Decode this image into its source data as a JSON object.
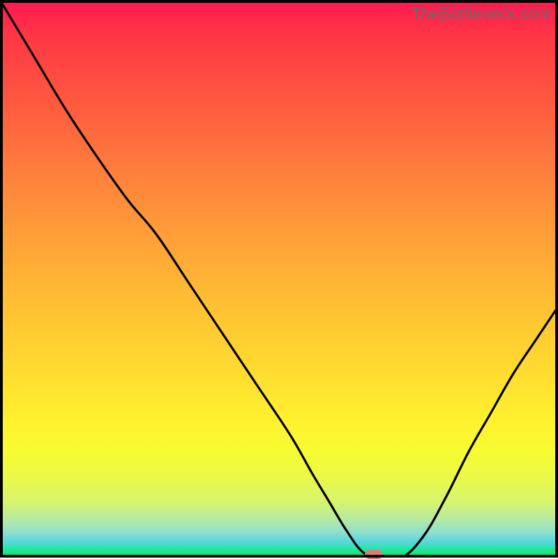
{
  "watermark": "TheBottleneck.com",
  "chart_data": {
    "type": "line",
    "title": "",
    "xlabel": "",
    "ylabel": "",
    "xlim": [
      0,
      100
    ],
    "ylim": [
      0,
      100
    ],
    "x": [
      0,
      6,
      12,
      18,
      23,
      28,
      34,
      40,
      46,
      52,
      56,
      59,
      62,
      65,
      68,
      72,
      76,
      80,
      84,
      88,
      92,
      96,
      100
    ],
    "y": [
      100,
      90,
      80,
      71,
      64,
      58,
      49,
      40,
      31,
      22,
      15,
      10,
      5,
      1,
      0,
      0,
      4,
      11,
      19,
      26,
      33,
      39,
      45
    ],
    "bottleneck_point": {
      "x": 67,
      "y": 0.5
    },
    "annotations": []
  },
  "colors": {
    "curve": "#000000",
    "marker": "#e07a77",
    "frame": "#000000",
    "gradient_top": "#ff1750",
    "gradient_bottom": "#0fd87a"
  }
}
